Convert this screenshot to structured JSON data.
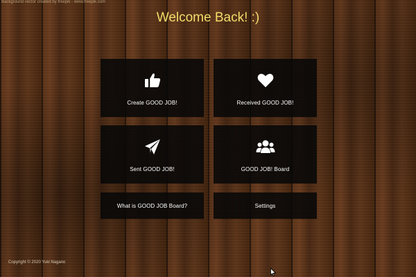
{
  "credit": "Background vector created by freepik - www.freepik.com",
  "title": "Welcome Back! :)",
  "tiles": [
    {
      "label": "Create GOOD JOB!",
      "icon": "thumbs-up-icon"
    },
    {
      "label": "Received GOOD JOB!",
      "icon": "heart-icon"
    },
    {
      "label": "Sent GOOD JOB!",
      "icon": "paper-plane-icon"
    },
    {
      "label": "GOOD JOB! Board",
      "icon": "users-icon"
    },
    {
      "label": "What is GOOD JOB Board?"
    },
    {
      "label": "Settings"
    }
  ],
  "footer": "Copyright © 2020 Yuki Nagano",
  "colors": {
    "title": "#f2dd6a",
    "tile_bg": "#080808",
    "tile_text": "#ffffff"
  }
}
